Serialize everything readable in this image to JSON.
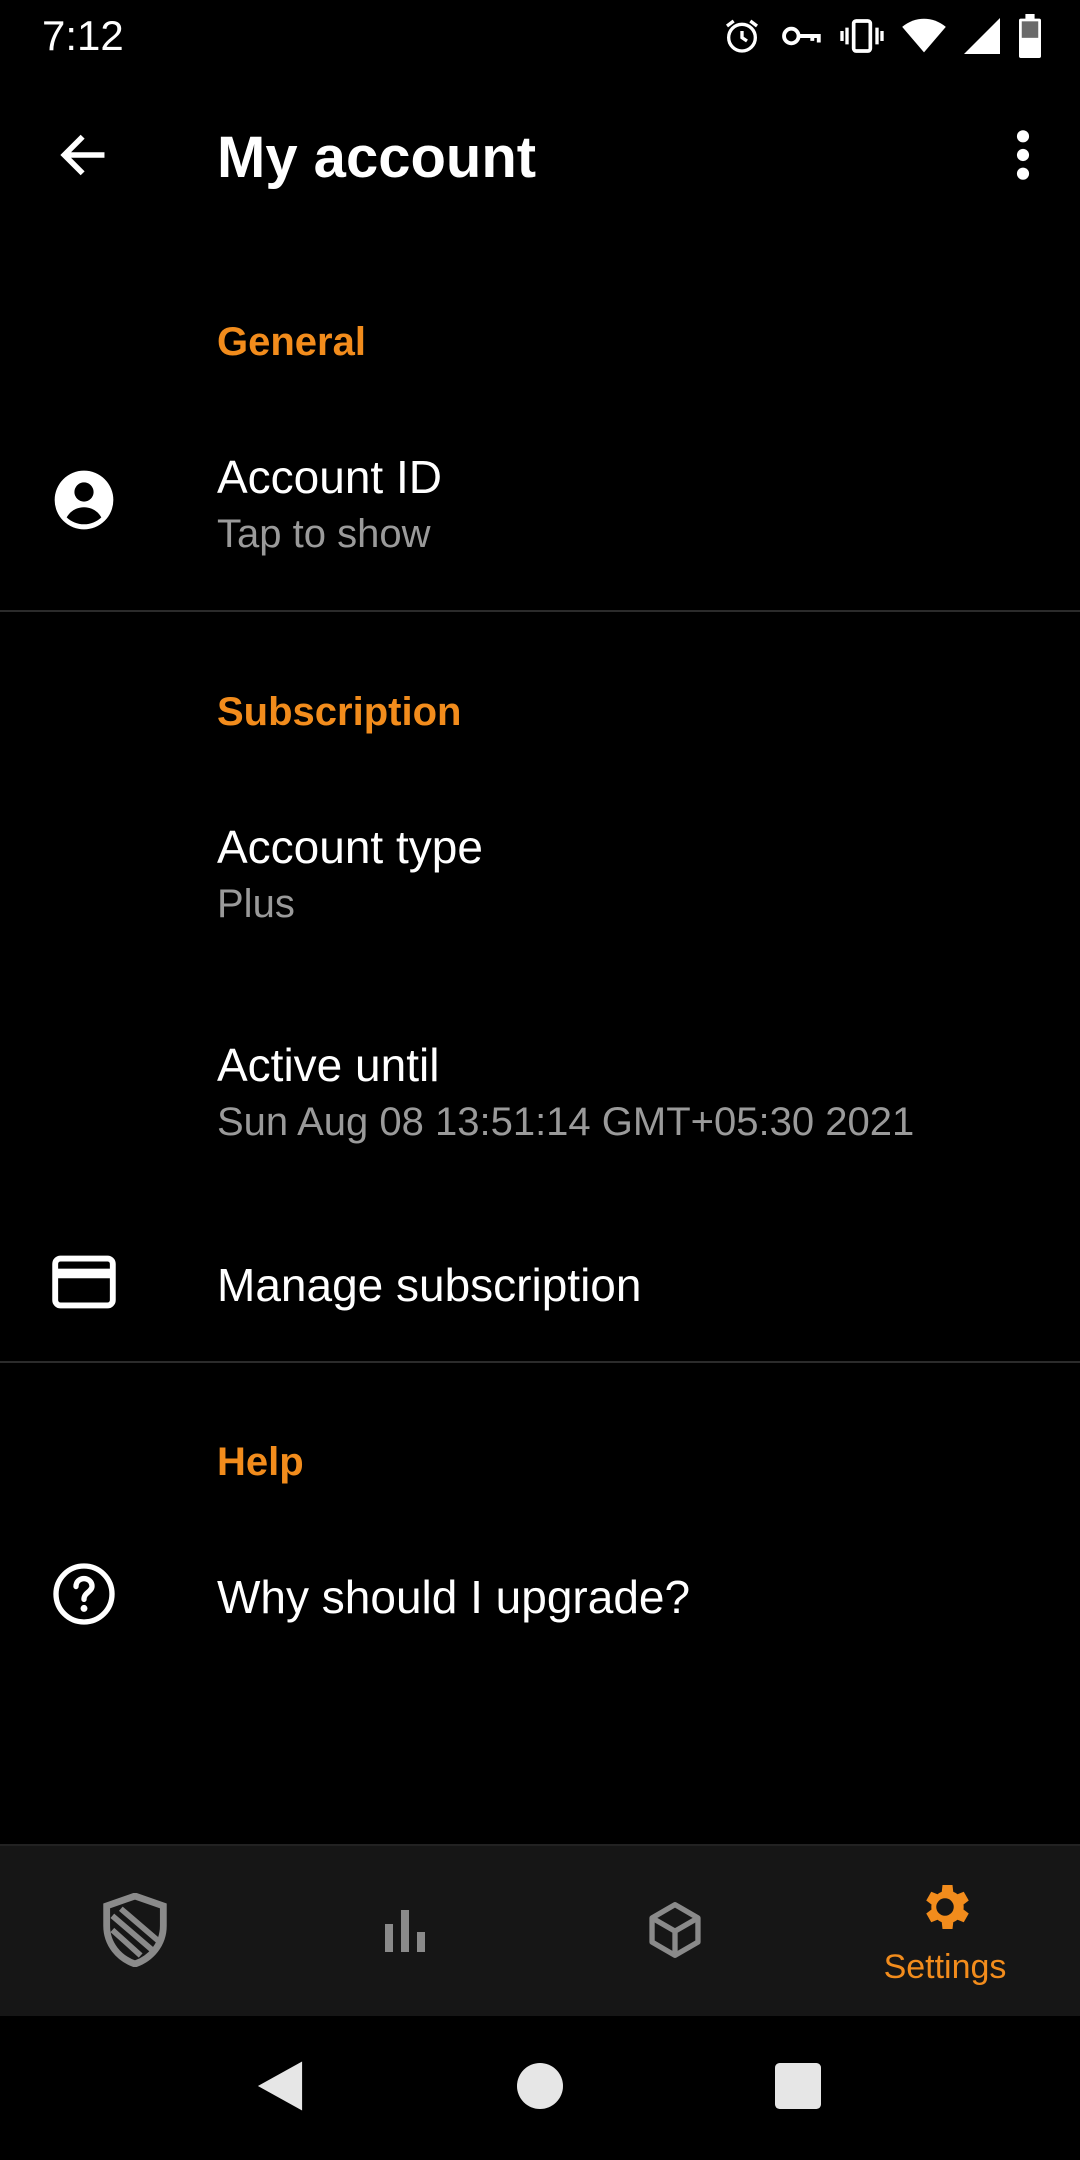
{
  "status_bar": {
    "time": "7:12",
    "icons": [
      "alarm-icon",
      "vpn-key-icon",
      "vibrate-icon",
      "wifi-icon",
      "signal-icon",
      "battery-icon"
    ]
  },
  "app_bar": {
    "title": "My account",
    "back_icon": "arrow-back-icon",
    "more_icon": "more-vert-icon"
  },
  "sections": {
    "general": {
      "header": "General",
      "account_id": {
        "title": "Account ID",
        "subtitle": "Tap to show",
        "icon": "account-circle-icon"
      }
    },
    "subscription": {
      "header": "Subscription",
      "account_type": {
        "title": "Account type",
        "subtitle": "Plus"
      },
      "active_until": {
        "title": "Active until",
        "subtitle": "Sun Aug 08 13:51:14 GMT+05:30 2021"
      },
      "manage": {
        "title": "Manage subscription",
        "icon": "credit-card-icon"
      }
    },
    "help": {
      "header": "Help",
      "upgrade": {
        "title": "Why should I upgrade?",
        "icon": "help-circle-icon"
      }
    }
  },
  "bottom_nav": {
    "items": [
      {
        "icon": "shield-icon",
        "label": ""
      },
      {
        "icon": "bar-chart-icon",
        "label": ""
      },
      {
        "icon": "package-icon",
        "label": ""
      },
      {
        "icon": "gear-icon",
        "label": "Settings",
        "selected": true
      }
    ]
  },
  "system_nav": [
    "back-triangle-icon",
    "home-circle-icon",
    "recents-square-icon"
  ],
  "colors": {
    "accent": "#F28C1C",
    "background": "#000000",
    "nav_background": "#161616",
    "secondary_text": "#9a9a9a",
    "icon_gray": "#8a8a8a"
  }
}
